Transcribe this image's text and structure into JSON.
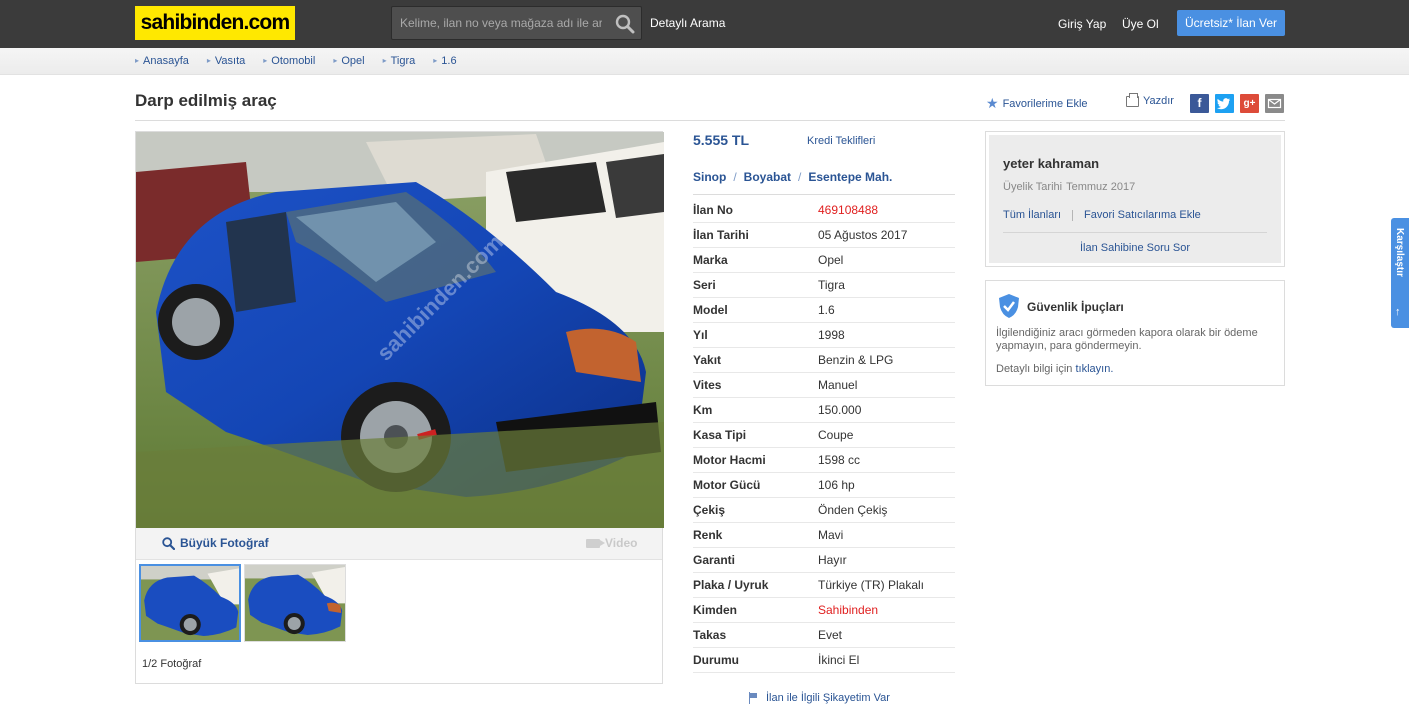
{
  "header": {
    "logo": "sahibinden.com",
    "search_placeholder": "Kelime, ilan no veya mağaza adı ile ara",
    "detailed_search": "Detaylı Arama",
    "login": "Giriş Yap",
    "register": "Üye Ol",
    "post_ad": "Ücretsiz* İlan Ver"
  },
  "breadcrumb": [
    "Anasayfa",
    "Vasıta",
    "Otomobil",
    "Opel",
    "Tigra",
    "1.6"
  ],
  "listing": {
    "title": "Darp edilmiş araç",
    "favorite": "Favorilerime Ekle",
    "print": "Yazdır",
    "price": "5.555 TL",
    "credit": "Kredi Teklifleri",
    "location": [
      "Sinop",
      "Boyabat",
      "Esentepe Mah."
    ],
    "specs": [
      {
        "key": "İlan No",
        "value": "469108488"
      },
      {
        "key": "İlan Tarihi",
        "value": "05 Ağustos 2017"
      },
      {
        "key": "Marka",
        "value": "Opel"
      },
      {
        "key": "Seri",
        "value": "Tigra"
      },
      {
        "key": "Model",
        "value": "1.6"
      },
      {
        "key": "Yıl",
        "value": "1998"
      },
      {
        "key": "Yakıt",
        "value": "Benzin & LPG"
      },
      {
        "key": "Vites",
        "value": "Manuel"
      },
      {
        "key": "Km",
        "value": "150.000"
      },
      {
        "key": "Kasa Tipi",
        "value": "Coupe"
      },
      {
        "key": "Motor Hacmi",
        "value": "1598 cc"
      },
      {
        "key": "Motor Gücü",
        "value": "106 hp"
      },
      {
        "key": "Çekiş",
        "value": "Önden Çekiş"
      },
      {
        "key": "Renk",
        "value": "Mavi"
      },
      {
        "key": "Garanti",
        "value": "Hayır"
      },
      {
        "key": "Plaka / Uyruk",
        "value": "Türkiye (TR) Plakalı"
      },
      {
        "key": "Kimden",
        "value": "Sahibinden"
      },
      {
        "key": "Takas",
        "value": "Evet"
      },
      {
        "key": "Durumu",
        "value": "İkinci El"
      }
    ],
    "complaint": "İlan ile İlgili Şikayetim Var"
  },
  "gallery": {
    "big_photo": "Büyük Fotoğraf",
    "video": "Video",
    "count": "1/2 Fotoğraf",
    "watermark": "sahibinden.com"
  },
  "seller": {
    "name": "yeter kahraman",
    "member_label": "Üyelik Tarihi",
    "member_since": "Temmuz 2017",
    "all_ads": "Tüm İlanları",
    "fav_seller": "Favori Satıcılarıma Ekle",
    "ask": "İlan Sahibine Soru Sor"
  },
  "safety": {
    "title": "Güvenlik İpuçları",
    "text": "İlgilendiğiniz aracı görmeden kapora olarak bir ödeme yapmayın, para göndermeyin.",
    "more_prefix": "Detaylı bilgi için",
    "more_link": "tıklayın."
  },
  "side_tab": "Karşılaştır",
  "colors": {
    "header_bg": "#3b3b3b",
    "logo_bg": "#ffe800",
    "accent_blue": "#4a90e2",
    "link_blue": "#2a5494",
    "highlight_red": "#e01f1f"
  }
}
